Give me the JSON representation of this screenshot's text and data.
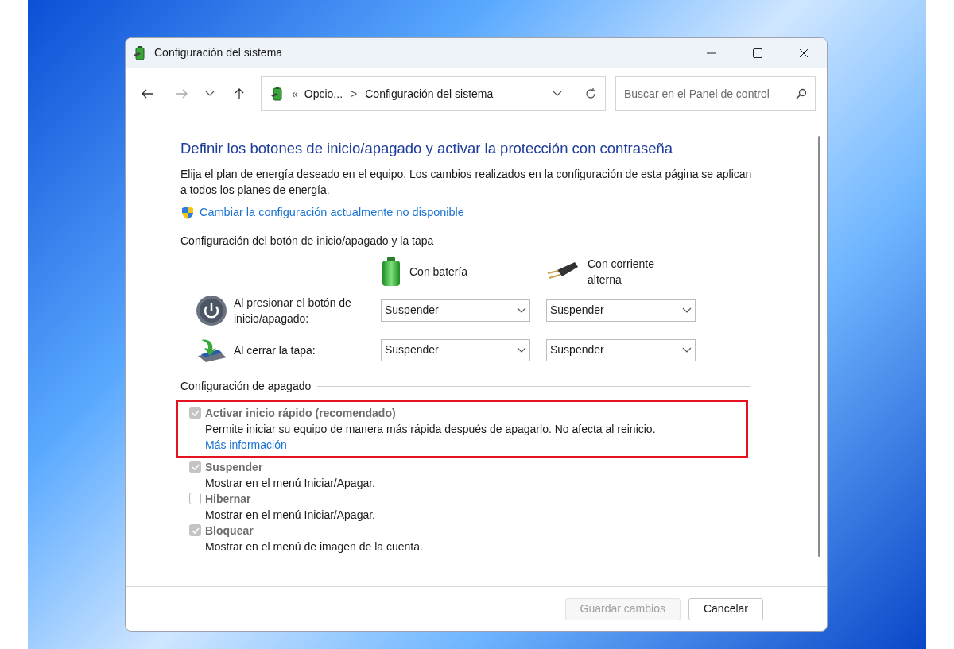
{
  "window": {
    "title": "Configuración del sistema"
  },
  "address_bar": {
    "overflow": "«",
    "crumbs": [
      "Opcio...",
      "Configuración del sistema"
    ],
    "separator": ">"
  },
  "search": {
    "placeholder": "Buscar en el Panel de control"
  },
  "heading": "Definir los botones de inicio/apagado y activar la protección con contraseña",
  "intro": "Elija el plan de energía deseado en el equipo. Los cambios realizados en la configuración de esta página se aplican a todos los planes de energía.",
  "admin_link": "Cambiar la configuración actualmente no disponible",
  "power_section": {
    "title": "Configuración del botón de inicio/apagado y la tapa",
    "columns": [
      {
        "kind": "battery",
        "label": "Con batería"
      },
      {
        "kind": "plug",
        "label": "Con corriente alterna"
      }
    ],
    "rows": [
      {
        "kind": "power",
        "label": "Al presionar el botón de inicio/apagado:",
        "values": [
          "Suspender",
          "Suspender"
        ]
      },
      {
        "kind": "lid",
        "label": "Al cerrar la tapa:",
        "values": [
          "Suspender",
          "Suspender"
        ]
      }
    ]
  },
  "shutdown_section": {
    "title": "Configuración de apagado",
    "options": [
      {
        "label": "Activar inicio rápido (recomendado)",
        "checked": true,
        "disabled": true,
        "highlighted": true,
        "description": "Permite iniciar su equipo de manera más rápida después de apagarlo. No afecta al reinicio.",
        "link": "Más información"
      },
      {
        "label": "Suspender",
        "checked": true,
        "disabled": true,
        "highlighted": false,
        "description": "Mostrar en el menú Iniciar/Apagar."
      },
      {
        "label": "Hibernar",
        "checked": false,
        "disabled": true,
        "highlighted": false,
        "description": "Mostrar en el menú Iniciar/Apagar."
      },
      {
        "label": "Bloquear",
        "checked": true,
        "disabled": true,
        "highlighted": false,
        "description": "Mostrar en el menú de imagen de la cuenta."
      }
    ]
  },
  "buttons": [
    {
      "label": "Guardar cambios",
      "disabled": true
    },
    {
      "label": "Cancelar",
      "disabled": false
    }
  ]
}
